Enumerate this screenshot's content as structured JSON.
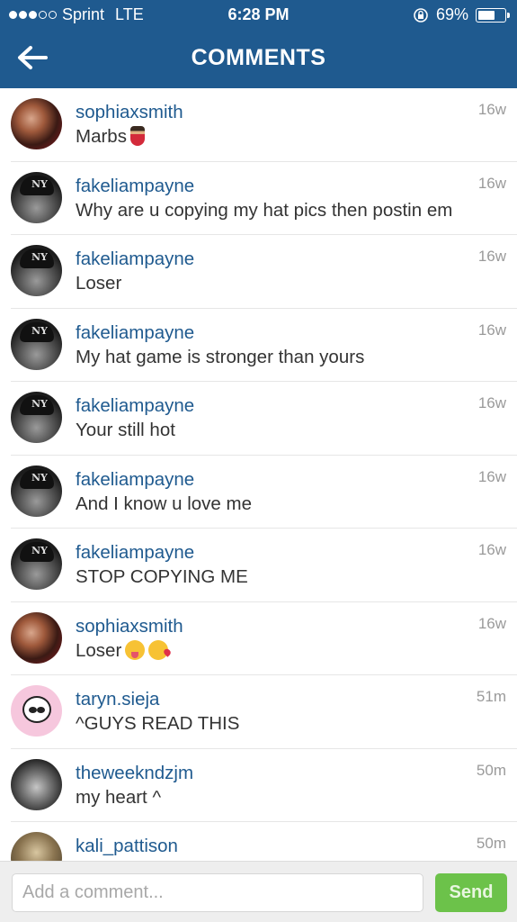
{
  "status_bar": {
    "carrier": "Sprint",
    "network": "LTE",
    "time": "6:28 PM",
    "battery": "69%",
    "battery_level": 0.69,
    "signal_dots_filled": 3,
    "signal_dots_total": 5
  },
  "header": {
    "title": "COMMENTS",
    "back_icon": "arrow-left-icon"
  },
  "comments": [
    {
      "username": "sophiaxsmith",
      "text": "Marbs",
      "time": "16w",
      "emoji": [
        "dancer"
      ]
    },
    {
      "username": "fakeliampayne",
      "text": "Why are u copying my hat pics then postin em",
      "time": "16w"
    },
    {
      "username": "fakeliampayne",
      "text": "Loser",
      "time": "16w"
    },
    {
      "username": "fakeliampayne",
      "text": "My hat game is stronger than yours",
      "time": "16w"
    },
    {
      "username": "fakeliampayne",
      "text": "Your still hot",
      "time": "16w"
    },
    {
      "username": "fakeliampayne",
      "text": "And I know u love me",
      "time": "16w"
    },
    {
      "username": "fakeliampayne",
      "text": "STOP COPYING ME",
      "time": "16w"
    },
    {
      "username": "sophiaxsmith",
      "text": "Loser",
      "time": "16w",
      "emoji": [
        "squinting-tongue",
        "kissing-heart"
      ]
    },
    {
      "username": "taryn.sieja",
      "text": "^GUYS READ THIS",
      "time": "51m"
    },
    {
      "username": "theweekndzjm",
      "text": "my heart ^",
      "time": "50m"
    },
    {
      "username": "kali_pattison",
      "text": "",
      "time": "50m"
    }
  ],
  "composer": {
    "placeholder": "Add a comment...",
    "value": "",
    "send_label": "Send"
  },
  "colors": {
    "header_bg": "#1f5a8f",
    "username": "#1f5a8f",
    "send_bg": "#6cc24a"
  }
}
